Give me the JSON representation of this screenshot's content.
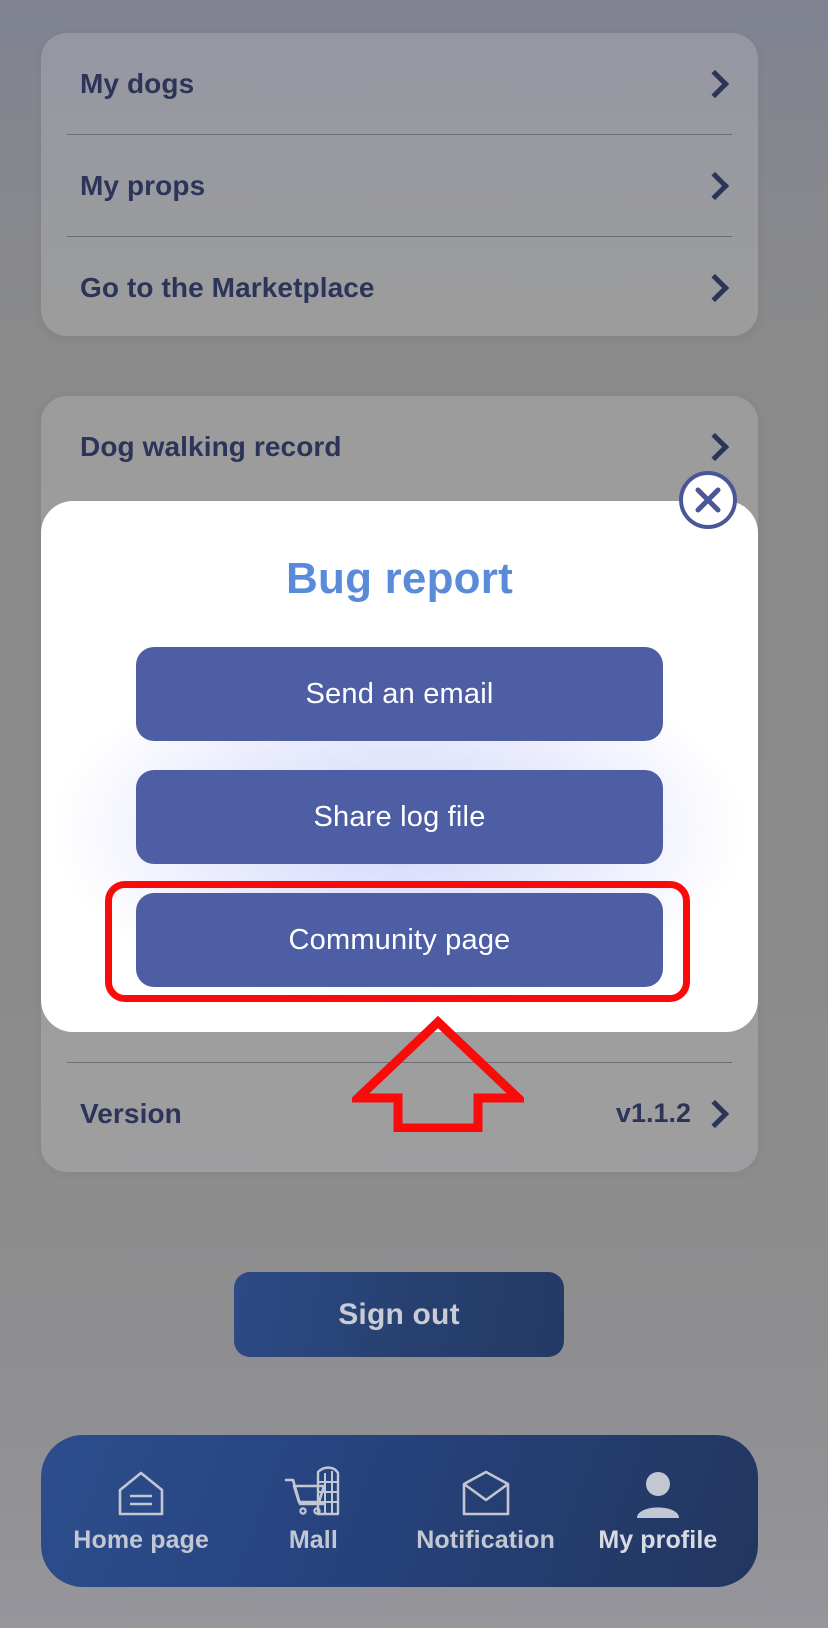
{
  "background_page": {
    "card_one": {
      "rows": [
        {
          "label": "My dogs",
          "chevron": "chevron-right-icon"
        },
        {
          "label": "My props",
          "chevron": "chevron-right-icon"
        },
        {
          "label": "Go to the Marketplace",
          "chevron": "chevron-right-icon"
        }
      ]
    },
    "card_two": {
      "rows": [
        {
          "label": "Dog walking record",
          "value": "",
          "chevron": "chevron-right-icon"
        },
        {
          "label": "Version",
          "value": "v1.1.2",
          "chevron": "chevron-right-icon"
        }
      ]
    },
    "sign_out_label": "Sign out"
  },
  "modal": {
    "title": "Bug report",
    "close_icon": "close-x-icon",
    "buttons": [
      {
        "label": "Send an email",
        "highlighted": false
      },
      {
        "label": "Share log file",
        "highlighted": false
      },
      {
        "label": "Community page",
        "highlighted": true
      }
    ]
  },
  "annotations": {
    "highlight_color": "#fb0a0a",
    "highlight_target": "Community page",
    "arrow_icon": "up-arrow-annotation-icon"
  },
  "bottom_nav": {
    "items": [
      {
        "label": "Home page",
        "icon": "home-icon",
        "active": false
      },
      {
        "label": "Mall",
        "icon": "shopping-cart-mall-icon",
        "active": false
      },
      {
        "label": "Notification",
        "icon": "envelope-icon",
        "active": false
      },
      {
        "label": "My profile",
        "icon": "person-icon",
        "active": true
      }
    ]
  },
  "colors": {
    "accent_blue": "#5a8ada",
    "button_blue": "#4d5ea5",
    "nav_navy": "#27447f",
    "text_navy": "#2c3559",
    "annotation_red": "#fb0a0a"
  }
}
